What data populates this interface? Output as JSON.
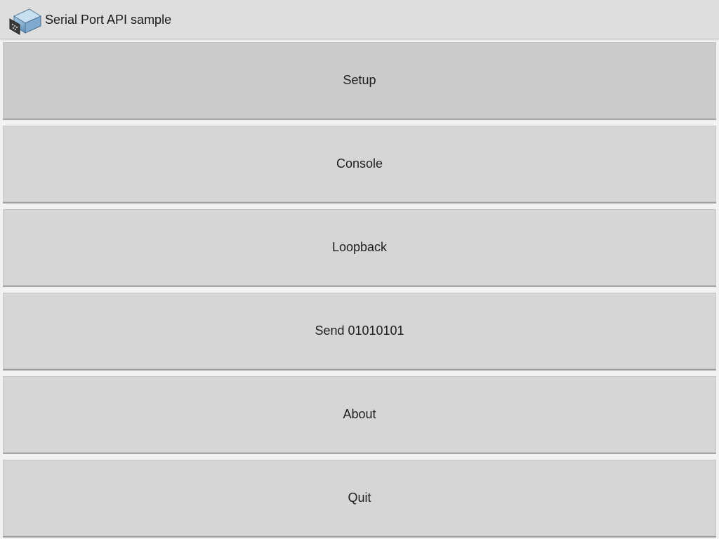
{
  "app": {
    "title": "Serial Port API sample",
    "icon": "serial-port-connector-icon"
  },
  "menu": {
    "buttons": [
      {
        "label": "Setup"
      },
      {
        "label": "Console"
      },
      {
        "label": "Loopback"
      },
      {
        "label": "Send 01010101"
      },
      {
        "label": "About"
      },
      {
        "label": "Quit"
      }
    ]
  },
  "colors": {
    "titlebar": "#dedede",
    "button": "#d6d6d6",
    "background": "#f2f2f2"
  }
}
